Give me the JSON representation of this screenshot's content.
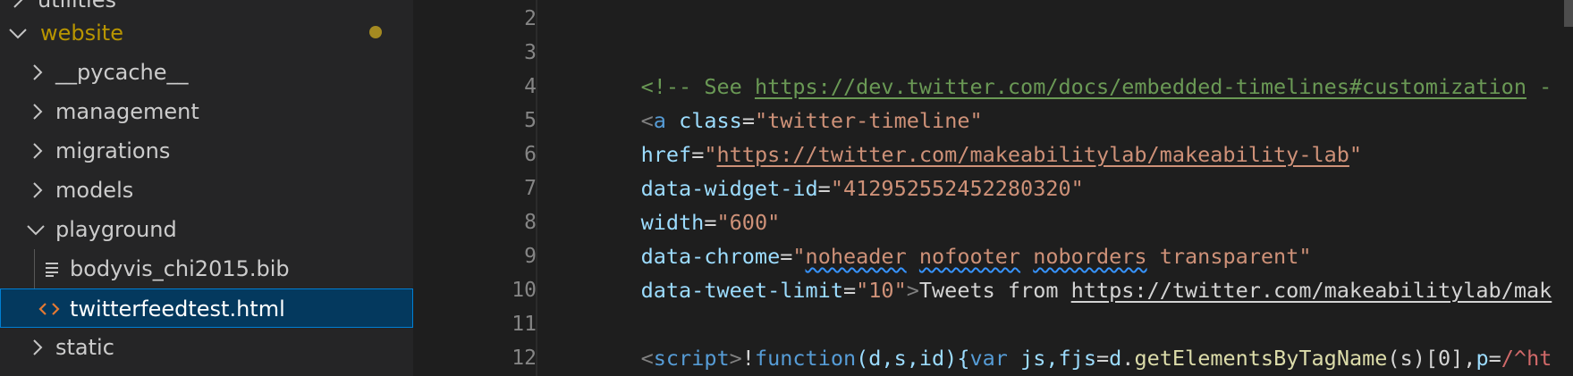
{
  "explorer": {
    "items": [
      {
        "label": "utilities",
        "type": "folder",
        "expanded": false,
        "depth": 0
      },
      {
        "label": "website",
        "type": "folder",
        "expanded": true,
        "depth": 0,
        "modified": true
      },
      {
        "label": "__pycache__",
        "type": "folder",
        "expanded": false,
        "depth": 1
      },
      {
        "label": "management",
        "type": "folder",
        "expanded": false,
        "depth": 1
      },
      {
        "label": "migrations",
        "type": "folder",
        "expanded": false,
        "depth": 1
      },
      {
        "label": "models",
        "type": "folder",
        "expanded": false,
        "depth": 1
      },
      {
        "label": "playground",
        "type": "folder",
        "expanded": true,
        "depth": 1
      },
      {
        "label": "bodyvis_chi2015.bib",
        "type": "file",
        "icon": "lines-file-icon",
        "depth": 2
      },
      {
        "label": "twitterfeedtest.html",
        "type": "file",
        "icon": "html-file-icon",
        "depth": 2,
        "selected": true
      },
      {
        "label": "static",
        "type": "folder",
        "expanded": false,
        "depth": 1
      }
    ]
  },
  "editor": {
    "line_numbers": [
      "2",
      "3",
      "4",
      "5",
      "6",
      "7",
      "8",
      "9",
      "10",
      "11",
      "12"
    ],
    "lines": {
      "l3": {
        "comment_open": "<!-- See ",
        "url": "https://dev.twitter.com/docs/embedded-timelines#customization",
        "comment_tail": " -"
      },
      "l4": {
        "open": "<",
        "tag": "a",
        "sp": " ",
        "attr": "class",
        "eq": "=",
        "val": "\"twitter-timeline\""
      },
      "l5": {
        "attr": "href",
        "eq": "=",
        "q1": "\"",
        "val": "https://twitter.com/makeabilitylab/makeability-lab",
        "q2": "\""
      },
      "l6": {
        "attr": "data-widget-id",
        "eq": "=",
        "val": "\"412952552452280320\""
      },
      "l7": {
        "attr": "width",
        "eq": "=",
        "val": "\"600\""
      },
      "l8": {
        "attr": "data-chrome",
        "eq": "=",
        "q1": "\"",
        "w1": "noheader",
        "s1": " ",
        "w2": "nofooter",
        "s2": " ",
        "w3": "noborders",
        "rest": " transparent\""
      },
      "l9": {
        "attr": "data-tweet-limit",
        "eq": "=",
        "val": "\"10\"",
        "close": ">",
        "text": "Tweets from ",
        "link": "https://twitter.com/makeabilitylab/mak"
      },
      "l11": {
        "open": "<",
        "tag": "script",
        "close": ">",
        "bang": "!",
        "kw_function": "function",
        "params": "(d,s,id){",
        "kw_var": "var",
        "sp": " ",
        "vars": "js,fjs",
        "eq": "=",
        "d": "d",
        "dot": ".",
        "method": "getElementsByTagName",
        "args": "(s)[0],",
        "p": "p",
        "eq2": "=",
        "regex": "/^ht"
      }
    }
  }
}
